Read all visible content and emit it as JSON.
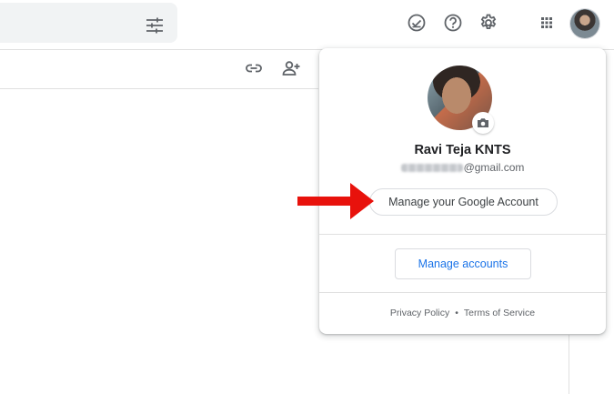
{
  "header": {
    "icons": [
      "tune-icon",
      "check-circle-icon",
      "help-icon",
      "settings-icon",
      "apps-grid-icon",
      "avatar"
    ]
  },
  "toolbar": {
    "icons": [
      "link-icon",
      "add-person-icon"
    ]
  },
  "account_popup": {
    "user_name": "Ravi Teja KNTS",
    "email_visible_suffix": "@gmail.com",
    "manage_google_account_label": "Manage your Google Account",
    "manage_accounts_label": "Manage accounts",
    "privacy_policy_label": "Privacy Policy",
    "separator": "•",
    "terms_label": "Terms of Service"
  },
  "colors": {
    "accent_blue": "#1a73e8",
    "arrow_red": "#e8120c",
    "search_bg": "#f1f3f4"
  }
}
